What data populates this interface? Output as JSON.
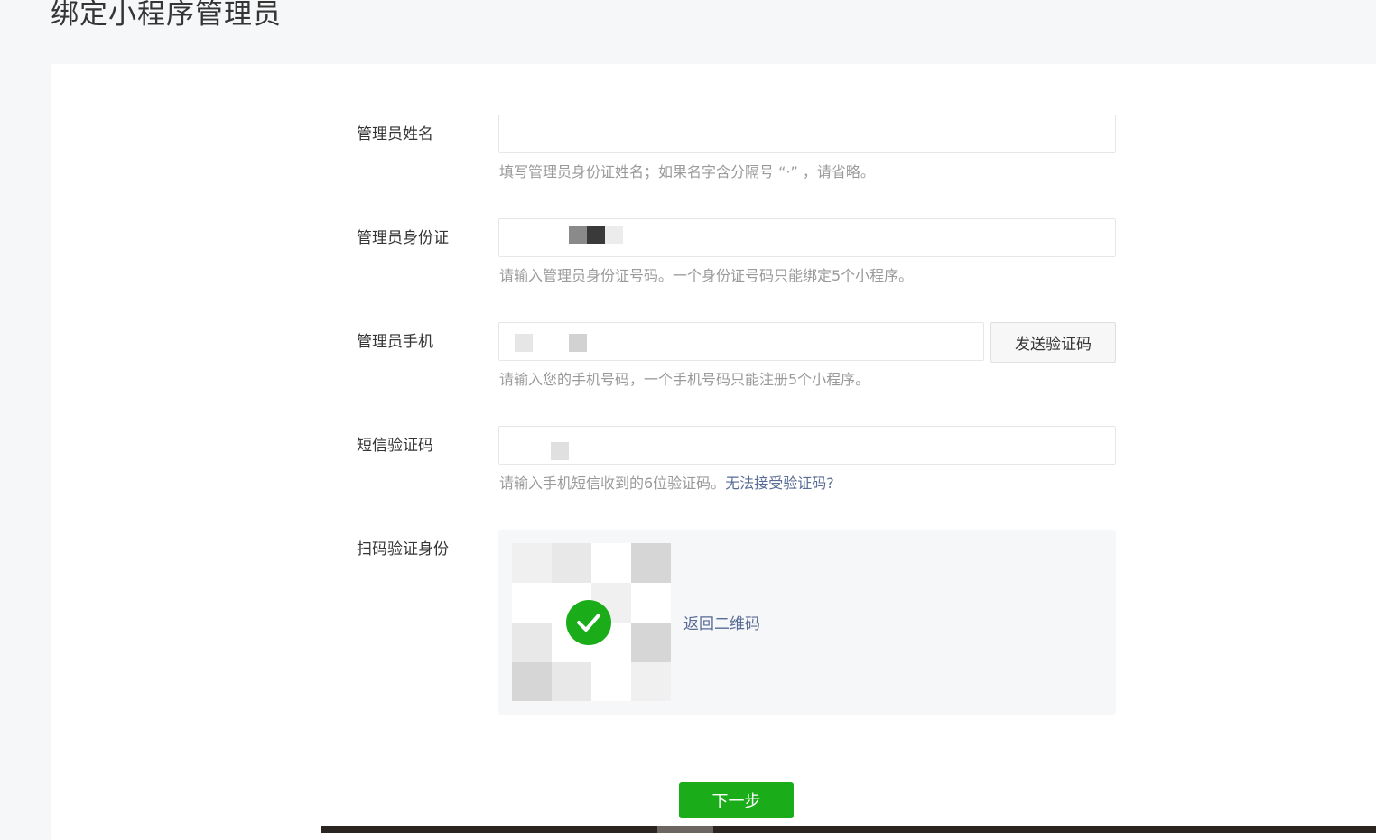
{
  "page": {
    "title": "绑定小程序管理员"
  },
  "form": {
    "name": {
      "label": "管理员姓名",
      "value": "",
      "hint": "填写管理员身份证姓名；如果名字含分隔号 “·” ，请省略。"
    },
    "id_card": {
      "label": "管理员身份证",
      "value": "",
      "hint": "请输入管理员身份证号码。一个身份证号码只能绑定5个小程序。"
    },
    "phone": {
      "label": "管理员手机",
      "value": "",
      "send_code_label": "发送验证码",
      "hint": "请输入您的手机号码，一个手机号码只能注册5个小程序。"
    },
    "sms_code": {
      "label": "短信验证码",
      "value": "",
      "hint": "请输入手机短信收到的6位验证码。",
      "hint_link": "无法接受验证码?"
    },
    "scan": {
      "label": "扫码验证身份",
      "status": "verified",
      "back_link": "返回二维码"
    }
  },
  "actions": {
    "next_label": "下一步"
  },
  "colors": {
    "primary_green": "#1aad19",
    "link_blue": "#576b95",
    "hint_gray": "#9a9a9a"
  },
  "icons": {
    "check": "check-icon",
    "qr": "qr-code-icon"
  }
}
